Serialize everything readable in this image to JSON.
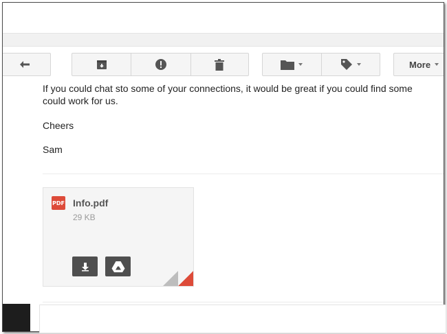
{
  "toolbar": {
    "reply_icon": "reply-arrow-icon",
    "archive_icon": "archive-box-icon",
    "spam_icon": "report-spam-icon",
    "delete_icon": "trash-icon",
    "move_icon": "folder-icon",
    "labels_icon": "tag-icon",
    "more_label": "More"
  },
  "message": {
    "line1": "If you could chat sto some of your connections, it would be great if you could find some",
    "line2": "could work for us.",
    "signoff": "Cheers",
    "signature": "Sam"
  },
  "attachment": {
    "type_badge": "PDF",
    "filename": "Info.pdf",
    "size": "29 KB",
    "download_icon": "download-icon",
    "drive_icon": "google-drive-icon"
  },
  "colors": {
    "pdf_red": "#dd4b39",
    "action_button": "#4f4f4f",
    "toolbar_bg": "#f5f5f5"
  }
}
